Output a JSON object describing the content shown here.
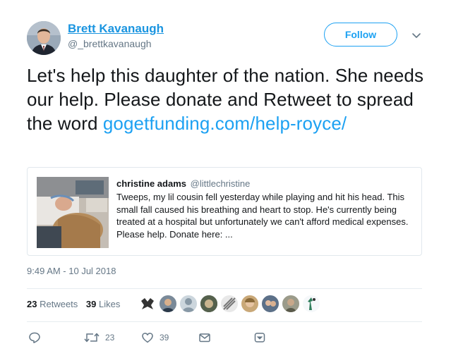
{
  "author": {
    "name": "Brett Kavanaugh",
    "handle": "@_brettkavanaugh"
  },
  "follow_button": "Follow",
  "tweet": {
    "text": "Let's help this daughter of the nation. She needs our help. Please donate and Retweet to spread the word ",
    "link": "gogetfunding.com/help-royce/"
  },
  "quoted": {
    "name": "christine adams",
    "handle": "@littlechristine",
    "text": "Tweeps, my lil cousin fell yesterday while playing and hit his head. This small fall caused his breathing and heart to stop. He's currently being treated at a hospital but unfortunately we can't afford medical expenses. Please help. Donate here: ..."
  },
  "timestamp": "9:49 AM - 10 Jul 2018",
  "stats": {
    "retweets_count": "23",
    "retweets_label": "Retweets",
    "likes_count": "39",
    "likes_label": "Likes"
  },
  "actions": {
    "reply_icon": "reply-icon",
    "retweet_icon": "retweet-icon",
    "retweet_count": "23",
    "like_icon": "heart-icon",
    "like_count": "39",
    "dm_icon": "envelope-icon",
    "more_icon": "chevron-down-icon"
  },
  "colors": {
    "link": "#1da1f2",
    "name": "#1b95e0",
    "muted": "#657786",
    "border": "#e1e8ed"
  }
}
